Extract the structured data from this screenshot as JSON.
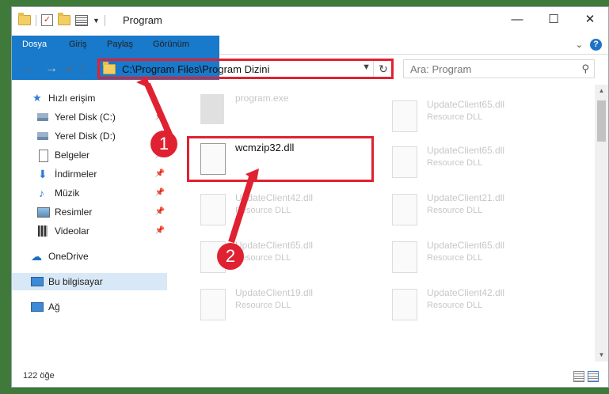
{
  "window": {
    "title": "Program"
  },
  "ribbon": {
    "tabs": [
      "Dosya",
      "Giriş",
      "Paylaş",
      "Görünüm"
    ]
  },
  "address": {
    "path": "C:\\Program Files\\Program Dizini"
  },
  "search": {
    "placeholder": "Ara: Program"
  },
  "sidebar": {
    "quick_access": "Hızlı erişim",
    "items": [
      "Yerel Disk (C:)",
      "Yerel Disk (D:)",
      "Belgeler",
      "İndirmeler",
      "Müzik",
      "Resimler",
      "Videolar"
    ],
    "onedrive": "OneDrive",
    "this_pc": "Bu bilgisayar",
    "network": "Ağ"
  },
  "files": [
    {
      "name": "program.exe",
      "desc": ""
    },
    {
      "name": "UpdateClient65.dll",
      "desc": "Resource DLL"
    },
    {
      "name": "wcmzip32.dll",
      "desc": ""
    },
    {
      "name": "UpdateClient65.dll",
      "desc": "Resource DLL"
    },
    {
      "name": "UpdateClient42.dll",
      "desc": "Resource DLL"
    },
    {
      "name": "UpdateClient21.dll",
      "desc": "Resource DLL"
    },
    {
      "name": "UpdateClient65.dll",
      "desc": "Resource DLL"
    },
    {
      "name": "UpdateClient65.dll",
      "desc": "Resource DLL"
    },
    {
      "name": "UpdateClient19.dll",
      "desc": "Resource DLL"
    },
    {
      "name": "UpdateClient42.dll",
      "desc": "Resource DLL"
    }
  ],
  "status": {
    "count": "122 öğe"
  },
  "callouts": [
    "1",
    "2"
  ],
  "colors": {
    "accent": "#1979ca",
    "highlight": "#e02131"
  }
}
